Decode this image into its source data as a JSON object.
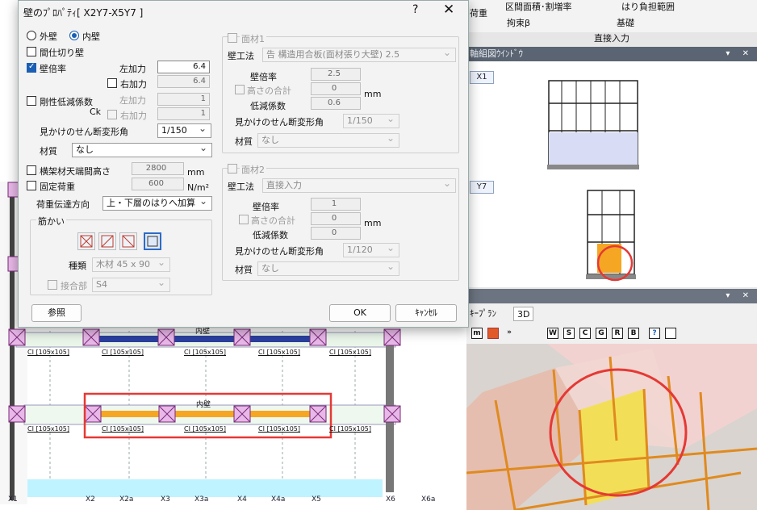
{
  "dialog": {
    "title": "壁のﾌﾟﾛﾊﾟﾃｨ[ X2Y7-X5Y7 ]",
    "help": "?",
    "close": "✕",
    "wall_type": {
      "outer": "外壁",
      "inner": "内壁",
      "selected": "inner"
    },
    "partition": "間仕切り壁",
    "wall_ratio": "壁倍率",
    "left_force": "左加力",
    "left_value": "6.4",
    "right_force": "右加力",
    "right_value": "6.4",
    "stiffness": "剛性低減係数",
    "ck": "Ck",
    "ck_left": "左加力",
    "ck_left_value": "1",
    "ck_right": "右加力",
    "ck_right_value": "1",
    "shear_angle": "見かけのせん断変形角",
    "shear_angle_value": "1/150",
    "material": "材質",
    "material_value": "なし",
    "beam_height": "横架材天端間高さ",
    "beam_height_value": "2800",
    "beam_height_unit": "mm",
    "fixed_load": "固定荷重",
    "fixed_load_value": "600",
    "fixed_load_unit": "N/m²",
    "load_transfer": "荷重伝達方向",
    "load_transfer_value": "上・下層のはりへ加算",
    "brace_group": "筋かい",
    "brace_kind": "種類",
    "brace_kind_value": "木材 45 x 90",
    "joint": "接合部",
    "joint_value": "S4",
    "panel1": {
      "title": "面材1",
      "method": "壁工法",
      "method_value": "告 構造用合板(面材張り大壁) 2.5",
      "ratio": "壁倍率",
      "ratio_value": "2.5",
      "height_sum": "高さの合計",
      "height_sum_value": "0",
      "unit": "mm",
      "reduction": "低減係数",
      "reduction_value": "0.6",
      "angle": "見かけのせん断変形角",
      "angle_value": "1/150",
      "material": "材質",
      "material_value": "なし"
    },
    "panel2": {
      "title": "面材2",
      "method": "壁工法",
      "method_value": "直接入力",
      "ratio": "壁倍率",
      "ratio_value": "1",
      "height_sum": "高さの合計",
      "height_sum_value": "0",
      "unit": "mm",
      "reduction": "低減係数",
      "reduction_value": "0",
      "angle": "見かけのせん断変形角",
      "angle_value": "1/120",
      "material": "材質",
      "material_value": "なし"
    },
    "reference_button": "参照",
    "ok_button": "OK",
    "cancel_button": "ｷｬﾝｾﾙ"
  },
  "ribbon": {
    "item1": "区間面積･割増率",
    "item2": "はり負担範囲",
    "item3": "拘束β",
    "item4": "基礎",
    "left_fragment": "荷重",
    "section": "直接入力"
  },
  "elevation": {
    "title": "軸組図ｳｲﾝﾄﾞｳ",
    "tag1": "X1",
    "tag2": "Y7"
  },
  "view3d": {
    "tab1": "ｷｰﾌﾟﾗﾝ",
    "tab2": "3D",
    "toolbar": [
      "m",
      "",
      "»",
      "",
      "W",
      "S",
      "C",
      "G",
      "R",
      "B",
      "?",
      ""
    ]
  },
  "plan": {
    "wall_label_top": "内壁",
    "wall_label_mid": "内壁",
    "beam_label": "CI [105x105]",
    "grid": [
      "X1",
      "X2",
      "X2a",
      "X3",
      "X3a",
      "X4",
      "X4a",
      "X5",
      "X6",
      "X6a"
    ]
  },
  "colors": {
    "highlight_red": "#e53935",
    "wall_orange": "#f5a623",
    "accent_blue": "#1a5fb4",
    "column_magenta": "#e8b8e8"
  }
}
